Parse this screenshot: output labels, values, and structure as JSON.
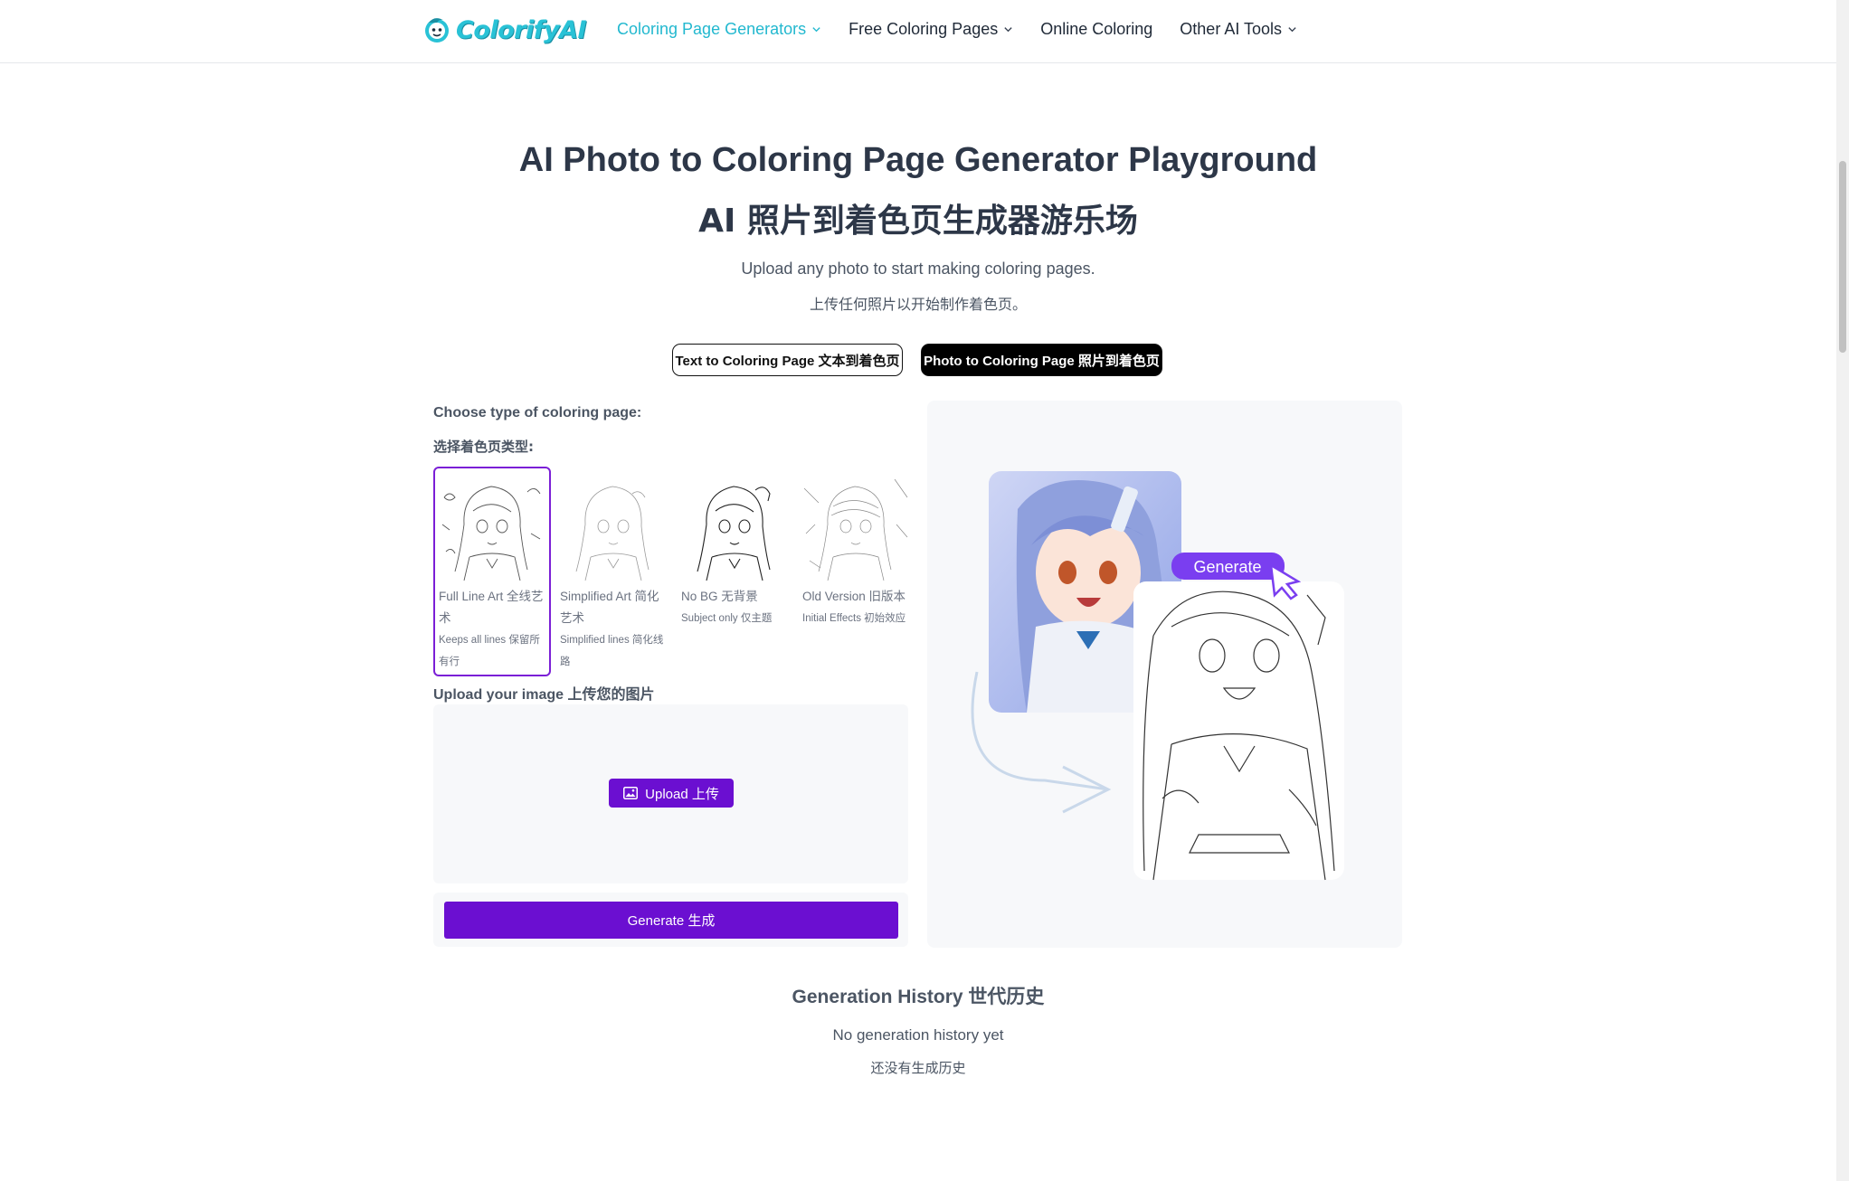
{
  "header": {
    "logo_text": "ColorifyAI",
    "nav": [
      {
        "label": "Coloring Page Generators",
        "has_dropdown": true,
        "active": true
      },
      {
        "label": "Free Coloring Pages",
        "has_dropdown": true,
        "active": false
      },
      {
        "label": "Online Coloring",
        "has_dropdown": false,
        "active": false
      },
      {
        "label": "Other AI Tools",
        "has_dropdown": true,
        "active": false
      }
    ]
  },
  "hero": {
    "title_en": "AI Photo to Coloring Page Generator Playground",
    "title_zh": "AI 照片到着色页生成器游乐场",
    "subtitle_en": "Upload any photo to start making coloring pages.",
    "subtitle_zh": "上传任何照片以开始制作着色页。"
  },
  "modes": [
    {
      "label": "Text to Coloring Page  文本到着色页",
      "selected": false
    },
    {
      "label": "Photo to Coloring Page  照片到着色页",
      "selected": true
    }
  ],
  "choose": {
    "label_en": "Choose type of coloring page:",
    "label_zh": "选择着色页类型:"
  },
  "types": [
    {
      "title": "Full Line Art  全线艺术",
      "desc": "Keeps all lines  保留所有行",
      "selected": true
    },
    {
      "title": "Simplified Art  简化艺术",
      "desc": "Simplified lines  简化线路",
      "selected": false
    },
    {
      "title": "No BG  无背景",
      "desc": "Subject only  仅主题",
      "selected": false
    },
    {
      "title": "Old Version  旧版本",
      "desc": "Initial Effects  初始效应",
      "selected": false
    }
  ],
  "upload": {
    "title": "Upload your image  上传您的图片",
    "button": "Upload  上传",
    "icon": "image-icon"
  },
  "generate_button": "Generate  生成",
  "preview": {
    "badge": "Generate"
  },
  "history": {
    "title": "Generation History  世代历史",
    "empty_en": "No generation history yet",
    "empty_zh": "还没有生成历史"
  },
  "colors": {
    "brand_purple": "#6b0fd1",
    "accent_cyan": "#22b8cf",
    "selected_border": "#7b1fd6"
  }
}
